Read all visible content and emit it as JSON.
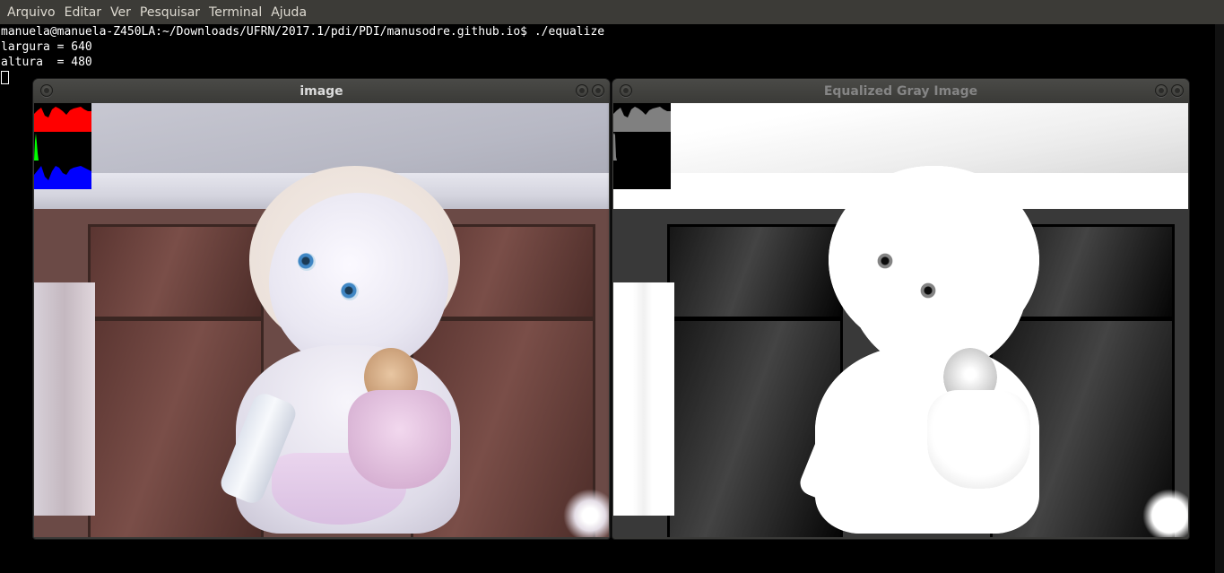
{
  "menubar": {
    "items": [
      "Arquivo",
      "Editar",
      "Ver",
      "Pesquisar",
      "Terminal",
      "Ajuda"
    ]
  },
  "terminal": {
    "lines": [
      "manuela@manuela-Z450LA:~/Downloads/UFRN/2017.1/pdi/PDI/manusodre.github.io$ ./equalize",
      "largura = 640",
      "altura  = 480"
    ]
  },
  "windows": {
    "left": {
      "title": "image",
      "active": true
    },
    "right": {
      "title": "Equalized Gray Image",
      "active": false
    }
  },
  "histograms": {
    "left": {
      "channels": [
        "red",
        "green",
        "blue"
      ],
      "colors": [
        "#ff0000",
        "#00ff00",
        "#0000ff"
      ]
    },
    "right": {
      "channels": [
        "gray"
      ],
      "colors": [
        "#808080"
      ]
    }
  }
}
